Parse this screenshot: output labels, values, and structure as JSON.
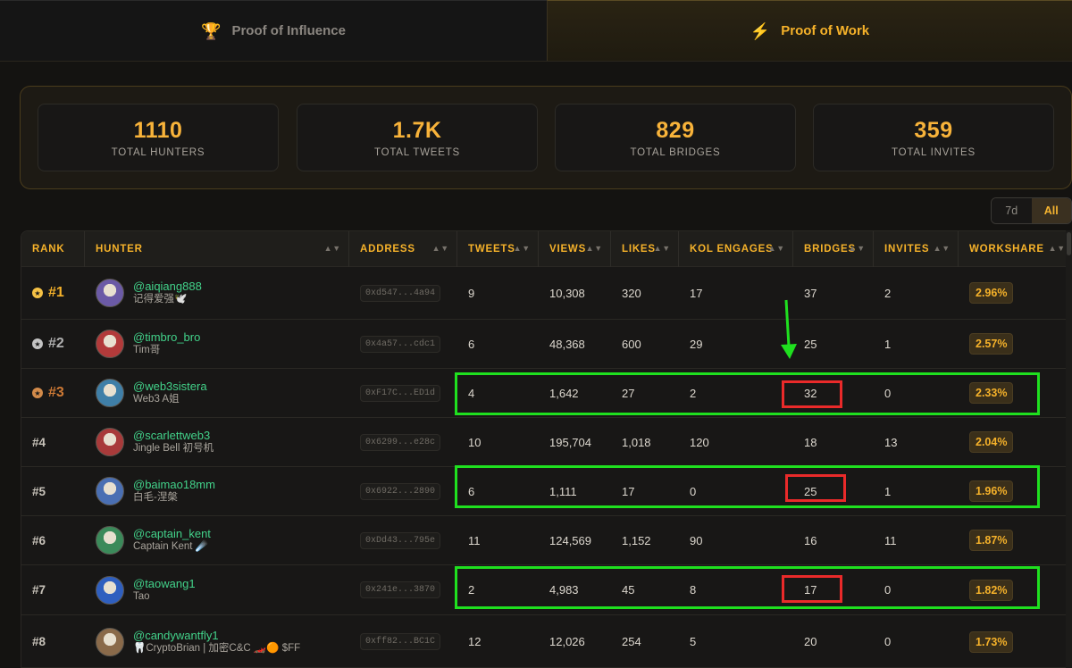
{
  "tabs": [
    {
      "label": "Proof of Influence",
      "icon": "trophy-icon"
    },
    {
      "label": "Proof of Work",
      "icon": "lightning-icon"
    }
  ],
  "stats": [
    {
      "value": "1110",
      "label": "TOTAL HUNTERS"
    },
    {
      "value": "1.7K",
      "label": "TOTAL TWEETS"
    },
    {
      "value": "829",
      "label": "TOTAL BRIDGES"
    },
    {
      "value": "359",
      "label": "TOTAL INVITES"
    }
  ],
  "period": {
    "options": [
      "7d",
      "All"
    ],
    "selected": "All"
  },
  "table": {
    "columns": [
      "RANK",
      "HUNTER",
      "ADDRESS",
      "TWEETS",
      "VIEWS",
      "LIKES",
      "KOL ENGAGES",
      "BRIDGES",
      "INVITES",
      "WORKSHARE"
    ],
    "rows": [
      {
        "rank": "#1",
        "handle": "@aiqiang888",
        "display": "记得爱强🕊️",
        "address": "0xd547...4a94",
        "tweets": "9",
        "views": "10,308",
        "likes": "320",
        "kol": "17",
        "bridges": "37",
        "invites": "2",
        "share": "2.96%"
      },
      {
        "rank": "#2",
        "handle": "@timbro_bro",
        "display": "Tim哥",
        "address": "0x4a57...cdc1",
        "tweets": "6",
        "views": "48,368",
        "likes": "600",
        "kol": "29",
        "bridges": "25",
        "invites": "1",
        "share": "2.57%"
      },
      {
        "rank": "#3",
        "handle": "@web3sistera",
        "display": "Web3 A姐",
        "address": "0xF17C...ED1d",
        "tweets": "4",
        "views": "1,642",
        "likes": "27",
        "kol": "2",
        "bridges": "32",
        "invites": "0",
        "share": "2.33%"
      },
      {
        "rank": "#4",
        "handle": "@scarlettweb3",
        "display": "Jingle Bell 初号机",
        "address": "0x6299...e28c",
        "tweets": "10",
        "views": "195,704",
        "likes": "1,018",
        "kol": "120",
        "bridges": "18",
        "invites": "13",
        "share": "2.04%"
      },
      {
        "rank": "#5",
        "handle": "@baimao18mm",
        "display": "白毛-涅槃",
        "address": "0x6922...2890",
        "tweets": "6",
        "views": "1,111",
        "likes": "17",
        "kol": "0",
        "bridges": "25",
        "invites": "1",
        "share": "1.96%"
      },
      {
        "rank": "#6",
        "handle": "@captain_kent",
        "display": "Captain Kent ☄️",
        "address": "0xDd43...795e",
        "tweets": "11",
        "views": "124,569",
        "likes": "1,152",
        "kol": "90",
        "bridges": "16",
        "invites": "11",
        "share": "1.87%"
      },
      {
        "rank": "#7",
        "handle": "@taowang1",
        "display": "Tao",
        "address": "0x241e...3870",
        "tweets": "2",
        "views": "4,983",
        "likes": "45",
        "kol": "8",
        "bridges": "17",
        "invites": "0",
        "share": "1.82%"
      },
      {
        "rank": "#8",
        "handle": "@candywantfly1",
        "display": "🦷CryptoBrian | 加密C&C 🏎️🟠 $FF",
        "address": "0xff82...BC1C",
        "tweets": "12",
        "views": "12,026",
        "likes": "254",
        "kol": "5",
        "bridges": "20",
        "invites": "0",
        "share": "1.73%"
      }
    ]
  },
  "colors": {
    "accent": "#f6b22a",
    "handle": "#42d28a",
    "highlight_green": "#1fe01f",
    "highlight_red": "#ea2a2a"
  }
}
